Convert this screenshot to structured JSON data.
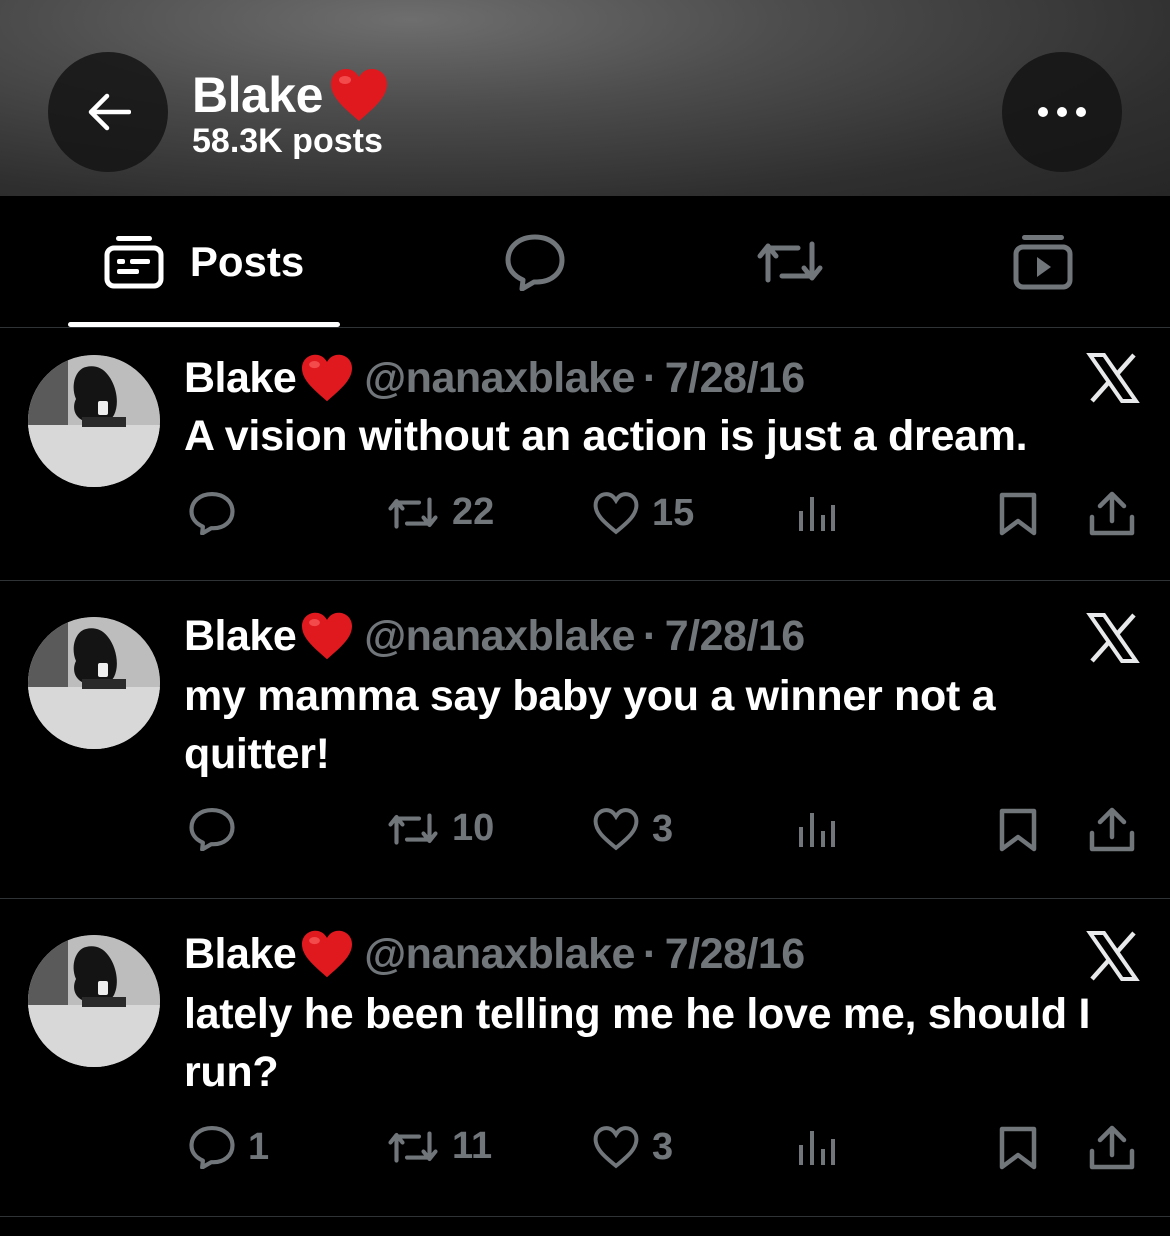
{
  "header": {
    "name": "Blake",
    "name_emoji": "red-heart",
    "post_count": "58.3K posts"
  },
  "tabs": [
    {
      "label": "Posts",
      "icon": "posts-icon",
      "active": true
    },
    {
      "label": "",
      "icon": "replies-icon",
      "active": false
    },
    {
      "label": "",
      "icon": "reposts-icon",
      "active": false
    },
    {
      "label": "",
      "icon": "media-icon",
      "active": false
    }
  ],
  "posts": [
    {
      "name": "Blake",
      "handle": "@nanaxblake",
      "separator": "·",
      "date": "7/28/16",
      "text": "A vision without an action is just a dream.",
      "replies": "",
      "reposts": "22",
      "likes": "15"
    },
    {
      "name": "Blake",
      "handle": "@nanaxblake",
      "separator": "·",
      "date": "7/28/16",
      "text": "my mamma say baby you a winner not a quitter!",
      "replies": "",
      "reposts": "10",
      "likes": "3"
    },
    {
      "name": "Blake",
      "handle": "@nanaxblake",
      "separator": "·",
      "date": "7/28/16",
      "text": "lately he been telling me he love me, should I run?",
      "replies": "1",
      "reposts": "11",
      "likes": "3"
    }
  ],
  "colors": {
    "background": "#000000",
    "text": "#e7e9ea",
    "muted": "#71767b",
    "heart": "#e0191f",
    "divider": "#2f3336"
  }
}
